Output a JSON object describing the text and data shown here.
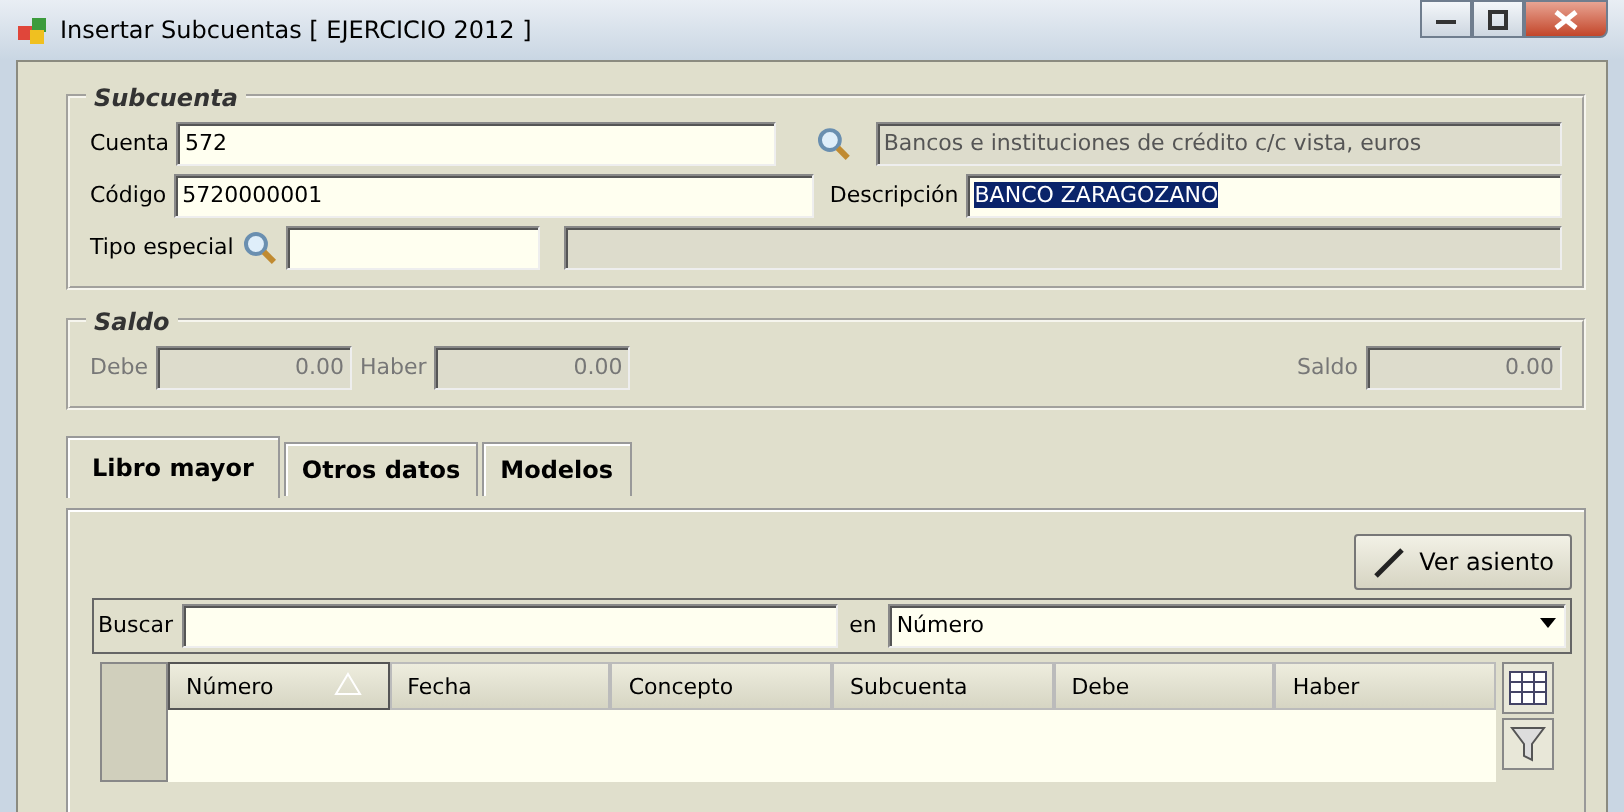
{
  "window": {
    "title": "Insertar Subcuentas [ EJERCICIO 2012 ]"
  },
  "subcuenta": {
    "title": "Subcuenta",
    "cuenta": {
      "label": "Cuenta",
      "value": "572",
      "description": "Bancos e instituciones de crédito c/c vista, euros"
    },
    "codigo": {
      "label": "Código",
      "value": "5720000001"
    },
    "descripcion": {
      "label": "Descripción",
      "value": "BANCO ZARAGOZANO",
      "selected": true
    },
    "tipo_especial": {
      "label": "Tipo especial"
    }
  },
  "saldo": {
    "title": "Saldo",
    "fields": [
      {
        "label": "Debe",
        "value": "0.00",
        "disabled": true
      },
      {
        "label": "Haber",
        "value": "0.00",
        "disabled": true
      },
      {
        "label": "Saldo",
        "value": "0.00",
        "disabled": true
      }
    ]
  },
  "tabs": [
    {
      "label": "Libro mayor",
      "selected": true
    },
    {
      "label": "Otros datos",
      "selected": false
    },
    {
      "label": "Modelos",
      "selected": false
    }
  ],
  "ver_asiento_button": "Ver asiento",
  "search": {
    "label": "Buscar",
    "in_label": "en",
    "field": "Número"
  },
  "table": {
    "columns": [
      {
        "label": "Número",
        "sorted": true
      },
      {
        "label": "Fecha",
        "sorted": false
      },
      {
        "label": "Concepto",
        "sorted": false
      },
      {
        "label": "Subcuenta",
        "sorted": false
      },
      {
        "label": "Debe",
        "sorted": false
      },
      {
        "label": "Haber",
        "sorted": false
      }
    ]
  }
}
